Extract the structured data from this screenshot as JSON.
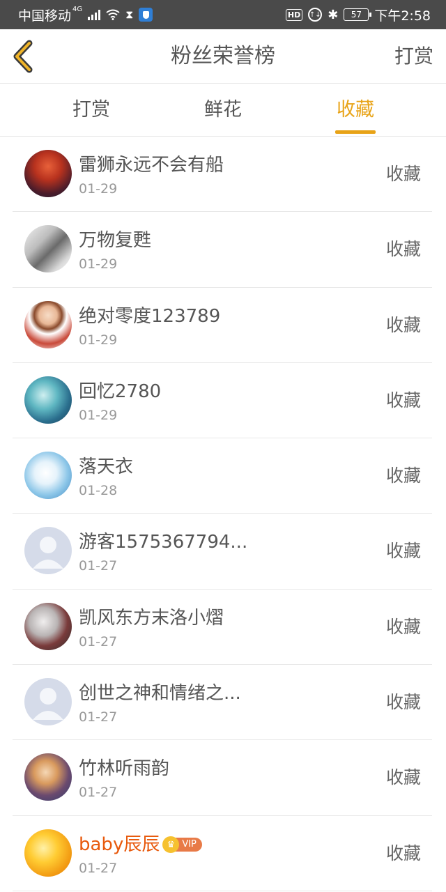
{
  "status_bar": {
    "carrier": "中国移动",
    "network": "4G",
    "battery": "57",
    "time": "下午2:58",
    "hd": "HD",
    "icons": [
      "signal-icon",
      "wifi-icon",
      "hourglass-icon",
      "shield-icon",
      "hd-icon",
      "data-saver-icon",
      "bluetooth-icon",
      "battery-icon"
    ]
  },
  "header": {
    "title": "粉丝荣誉榜",
    "action": "打赏",
    "back_icon": "chevron-left-icon",
    "accent": "#e8a317"
  },
  "tabs": [
    {
      "label": "打赏",
      "active": false
    },
    {
      "label": "鲜花",
      "active": false
    },
    {
      "label": "收藏",
      "active": true
    }
  ],
  "fans": [
    {
      "name": "雷狮永远不会有船",
      "date": "01-29",
      "action": "收藏",
      "avatar": "avatar-red-hair"
    },
    {
      "name": "万物复甦",
      "date": "01-29",
      "action": "收藏",
      "avatar": "avatar-sketch"
    },
    {
      "name": "绝对零度123789",
      "date": "01-29",
      "action": "收藏",
      "avatar": "avatar-boy"
    },
    {
      "name": "回忆2780",
      "date": "01-29",
      "action": "收藏",
      "avatar": "avatar-teal"
    },
    {
      "name": "落天衣",
      "date": "01-28",
      "action": "收藏",
      "avatar": "avatar-blue-white"
    },
    {
      "name": "游客1575367794...",
      "date": "01-27",
      "action": "收藏",
      "avatar": "avatar-default"
    },
    {
      "name": "凯风东方末洛小熠",
      "date": "01-27",
      "action": "收藏",
      "avatar": "avatar-knight"
    },
    {
      "name": "创世之神和情绪之...",
      "date": "01-27",
      "action": "收藏",
      "avatar": "avatar-default"
    },
    {
      "name": "竹林听雨韵",
      "date": "01-27",
      "action": "收藏",
      "avatar": "avatar-warm"
    },
    {
      "name": "baby辰辰",
      "date": "01-27",
      "action": "收藏",
      "avatar": "avatar-orange",
      "vip": true,
      "vip_label": "VIP"
    }
  ]
}
